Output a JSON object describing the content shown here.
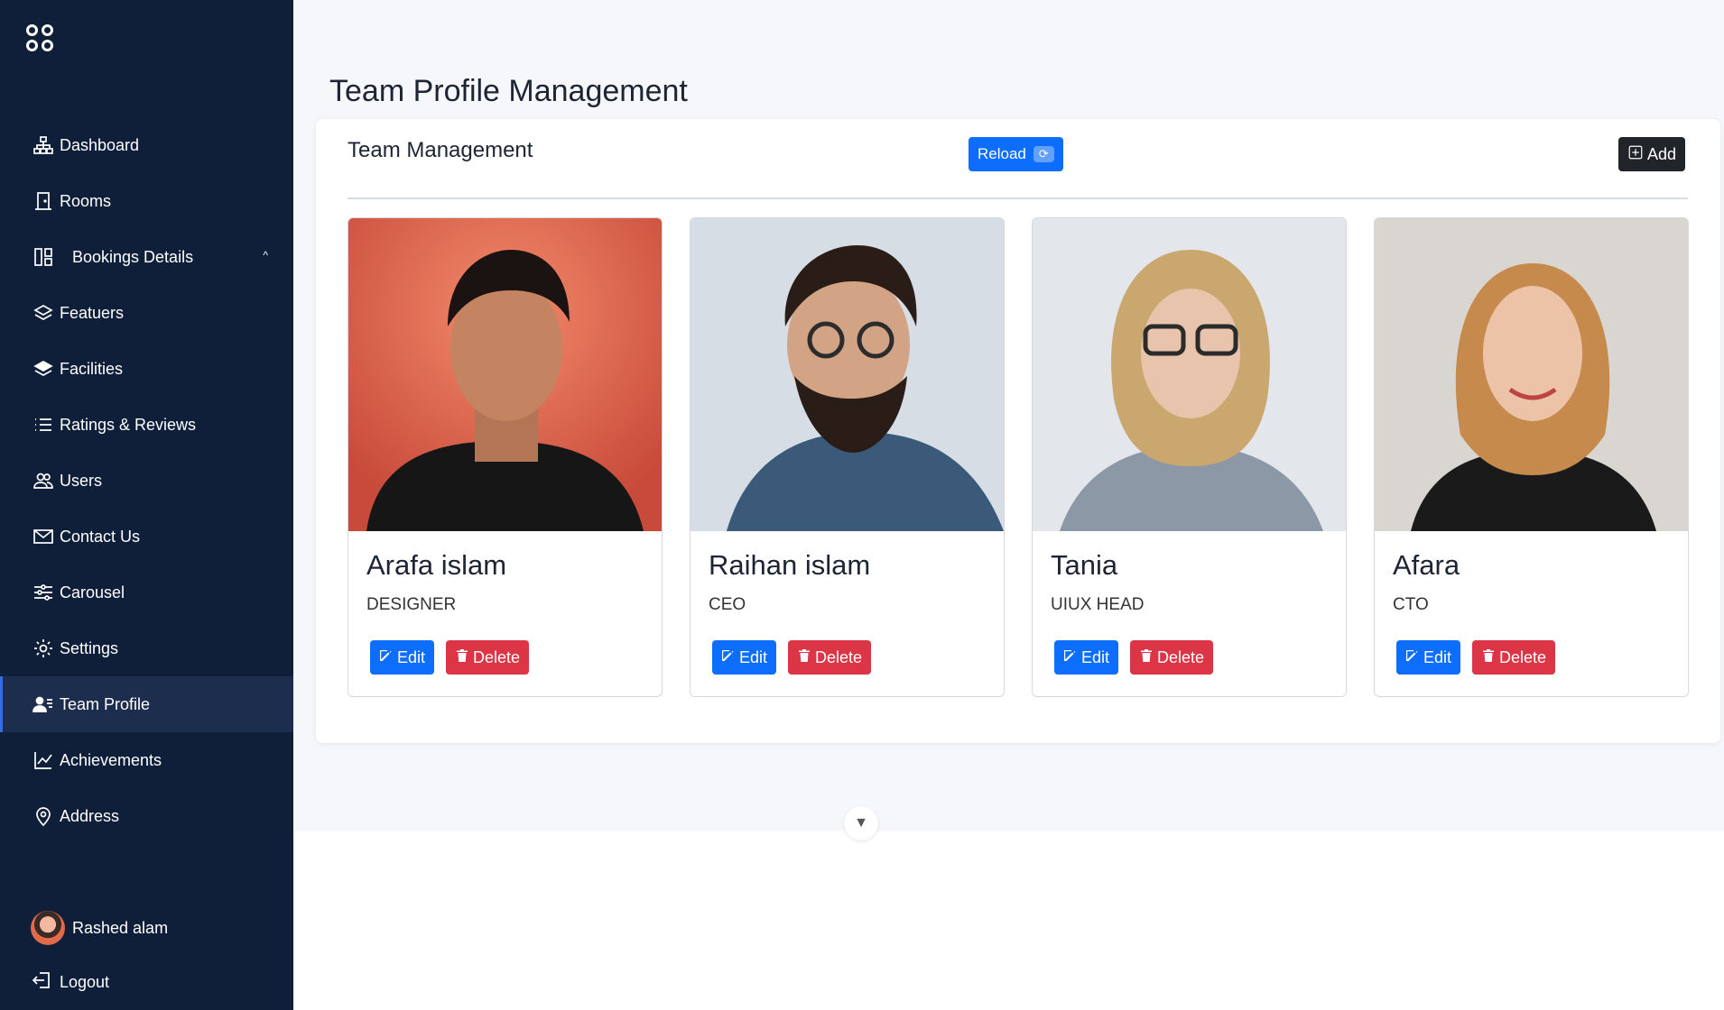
{
  "sidebar": {
    "items": [
      {
        "label": "Dashboard",
        "icon": "sitemap-icon"
      },
      {
        "label": "Rooms",
        "icon": "door-icon"
      },
      {
        "label": "Bookings Details",
        "icon": "layout-icon"
      },
      {
        "label": "Featuers",
        "icon": "layers-icon"
      },
      {
        "label": "Facilities",
        "icon": "layers-filled-icon"
      },
      {
        "label": "Ratings & Reviews",
        "icon": "list-icon"
      },
      {
        "label": "Users",
        "icon": "people-icon"
      },
      {
        "label": "Contact Us",
        "icon": "envelope-icon"
      },
      {
        "label": "Carousel",
        "icon": "sliders-icon"
      },
      {
        "label": "Settings",
        "icon": "gear-icon"
      },
      {
        "label": "Team Profile",
        "icon": "person-lines-icon"
      },
      {
        "label": "Achievements",
        "icon": "graph-up-icon"
      },
      {
        "label": "Address",
        "icon": "geo-pin-icon"
      }
    ],
    "active": "Team Profile",
    "user_name": "Rashed alam",
    "logout_label": "Logout"
  },
  "page": {
    "title": "Team Profile Management",
    "panel_title": "Team Management",
    "reload_label": "Reload",
    "add_label": "Add"
  },
  "team": [
    {
      "name": "Arafa islam",
      "role": "DESIGNER"
    },
    {
      "name": "Raihan islam",
      "role": "CEO"
    },
    {
      "name": "Tania",
      "role": "UIUX HEAD"
    },
    {
      "name": "Afara",
      "role": "CTO"
    }
  ],
  "actions": {
    "edit_label": "Edit",
    "delete_label": "Delete"
  },
  "colors": {
    "sidebar_bg": "#0f1f3a",
    "primary": "#0d6efd",
    "danger": "#dc3545",
    "dark": "#212529"
  }
}
